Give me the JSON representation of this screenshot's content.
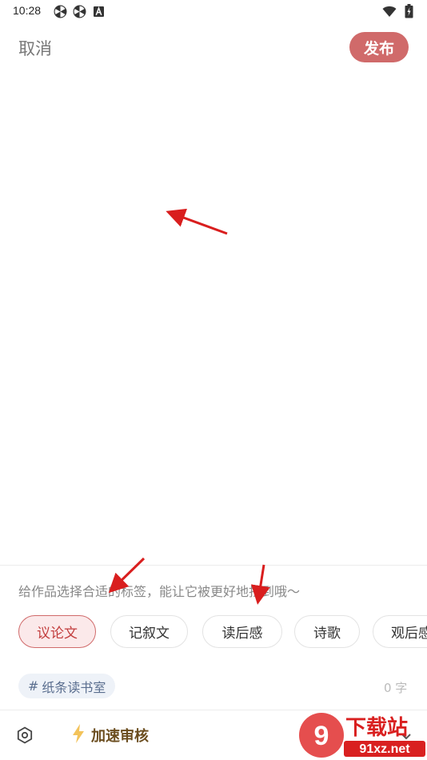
{
  "status_bar": {
    "time": "10:28",
    "left_icons": [
      "pinwheel-icon",
      "pinwheel-icon",
      "a-box-icon"
    ],
    "right_icons": [
      "wifi-icon",
      "battery-icon"
    ]
  },
  "header": {
    "cancel_label": "取消",
    "publish_label": "发布"
  },
  "tags": {
    "hint": "给作品选择合适的标签，能让它被更好地找到哦～",
    "items": [
      {
        "label": "议论文",
        "selected": true
      },
      {
        "label": "记叙文",
        "selected": false
      },
      {
        "label": "读后感",
        "selected": false
      },
      {
        "label": "诗歌",
        "selected": false
      },
      {
        "label": "观后感",
        "selected": false
      }
    ]
  },
  "room": {
    "prefix": "#",
    "name": "纸条读书室"
  },
  "word_count": "0 字",
  "bottom": {
    "speed_label": "加速审核"
  },
  "watermark": {
    "text_top": "下载站",
    "text_bottom": "91xz.net"
  },
  "colors": {
    "accent": "#d06a6a",
    "tag_selected_bg": "#fbe9ea",
    "room_chip_bg": "#eef2f8",
    "annotation_arrow": "#d91e1e"
  }
}
